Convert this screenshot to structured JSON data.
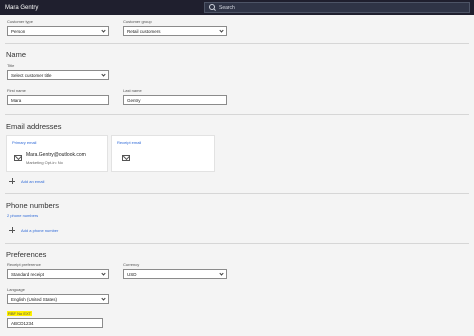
{
  "header": {
    "app_title": "Mara Gentry",
    "search_placeholder": "Search"
  },
  "customer": {
    "type_label": "Customer type",
    "type_value": "Person",
    "group_label": "Customer group",
    "group_value": "Retail customers"
  },
  "name_section": {
    "title": "Name",
    "title_label": "Title",
    "title_value": "Select customer title",
    "first_name_label": "First name",
    "first_name_value": "Mara",
    "last_name_label": "Last name",
    "last_name_value": "Gentry"
  },
  "email_section": {
    "title": "Email addresses",
    "primary_label": "Primary email",
    "primary_address": "Mara.Gentry@outlook.com",
    "primary_opt": "Marketing Opt-in: No",
    "receipt_label": "Receipt email",
    "add_label": "Add an email"
  },
  "phone_section": {
    "title": "Phone numbers",
    "count_label": "2 phone numbers",
    "add_label": "Add a phone number"
  },
  "preferences": {
    "title": "Preferences",
    "receipt_pref_label": "Receipt preference",
    "receipt_pref_value": "Standard receipt",
    "currency_label": "Currency",
    "currency_value": "USD",
    "language_label": "Language",
    "language_value": "English (United States)",
    "ext_label": "RBF No EXT",
    "ext_value": "ABCD1234"
  }
}
